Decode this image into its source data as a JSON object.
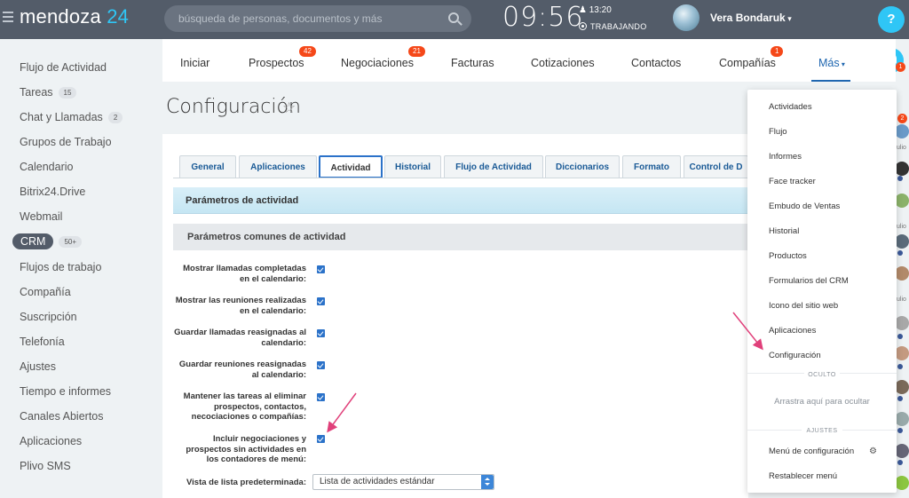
{
  "header": {
    "logo_text": "mendoza",
    "logo_num": "24",
    "search_placeholder": "búsqueda de personas, documentos y más",
    "clock": "09:56",
    "alarm": "13:20",
    "work_status": "TRABAJANDO",
    "username": "Vera Bondaruk",
    "help": "?"
  },
  "sidebar": {
    "items": [
      {
        "label": "Flujo de Actividad"
      },
      {
        "label": "Tareas",
        "badge": "15"
      },
      {
        "label": "Chat y Llamadas",
        "badge": "2"
      },
      {
        "label": "Grupos de Trabajo"
      },
      {
        "label": "Calendario"
      },
      {
        "label": "Bitrix24.Drive"
      },
      {
        "label": "Webmail"
      },
      {
        "label": "CRM",
        "badge": "50+"
      },
      {
        "label": "Flujos de trabajo"
      },
      {
        "label": "Compañía"
      },
      {
        "label": "Suscripción"
      },
      {
        "label": "Telefonía"
      },
      {
        "label": "Ajustes"
      },
      {
        "label": "Tiempo e informes"
      },
      {
        "label": "Canales Abiertos"
      },
      {
        "label": "Aplicaciones"
      },
      {
        "label": "Plivo SMS"
      }
    ]
  },
  "topnav": {
    "items": [
      {
        "label": "Iniciar"
      },
      {
        "label": "Prospectos",
        "badge": "42"
      },
      {
        "label": "Negociaciones",
        "badge": "21"
      },
      {
        "label": "Facturas"
      },
      {
        "label": "Cotizaciones"
      },
      {
        "label": "Contactos"
      },
      {
        "label": "Compañías",
        "badge": "1"
      },
      {
        "label": "Más"
      }
    ]
  },
  "page": {
    "title": "Configuración"
  },
  "tabs": [
    {
      "label": "General"
    },
    {
      "label": "Aplicaciones"
    },
    {
      "label": "Actividad"
    },
    {
      "label": "Historial"
    },
    {
      "label": "Flujo de Actividad"
    },
    {
      "label": "Diccionarios"
    },
    {
      "label": "Formato"
    },
    {
      "label": "Control de D"
    }
  ],
  "sections": {
    "activity_params": "Parámetros de actividad",
    "common_params": "Parámetros comunes de actividad"
  },
  "settings": [
    {
      "label": "Mostrar llamadas completadas en el calendario:",
      "checked": true
    },
    {
      "label": "Mostrar las reuniones realizadas en el calendario:",
      "checked": true
    },
    {
      "label": "Guardar llamadas reasignadas al calendario:",
      "checked": true
    },
    {
      "label": "Guardar reuniones reasignadas al calendario:",
      "checked": true
    },
    {
      "label": "Mantener las tareas al eliminar prospectos, contactos, necociaciones o compañías:",
      "checked": true
    },
    {
      "label": "Incluir negociaciones y prospectos sin actividades en los contadores de menú:",
      "checked": true
    }
  ],
  "default_list": {
    "label": "Vista de lista predeterminada:",
    "value": "Lista de actividades estándar"
  },
  "dropdown": {
    "items": [
      {
        "label": "Actividades"
      },
      {
        "label": "Flujo"
      },
      {
        "label": "Informes"
      },
      {
        "label": "Face tracker"
      },
      {
        "label": "Embudo de Ventas"
      },
      {
        "label": "Historial"
      },
      {
        "label": "Productos"
      },
      {
        "label": "Formularios del CRM"
      },
      {
        "label": "Icono del sitio web"
      },
      {
        "label": "Aplicaciones"
      },
      {
        "label": "Configuración"
      }
    ],
    "hidden_header": "OCULTO",
    "hidden_note": "Arrastra aquí para ocultar",
    "settings_header": "AJUSTES",
    "menu_config": "Menú de configuración",
    "reset_menu": "Restablecer menú"
  },
  "right_strip": {
    "bell_badge": "1",
    "chat_badge": "2",
    "labels": [
      "ulio",
      "ulio",
      "ulio"
    ]
  },
  "colors": {
    "header_bg": "#535c69",
    "accent": "#2fc6f6",
    "badge": "#f54819",
    "link": "#2067b0",
    "annotation_arrow": "#e0407a"
  }
}
